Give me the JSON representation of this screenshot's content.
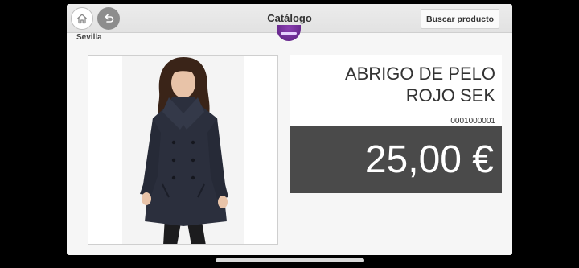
{
  "navbar": {
    "title": "Catálogo",
    "search_button_label": "Buscar producto",
    "home_icon": "home-icon",
    "back_icon": "undo-arrow-icon"
  },
  "store": {
    "location": "Sevilla"
  },
  "product": {
    "name_line1": "ABRIGO DE PELO",
    "name_line2": "ROJO SEK",
    "code": "0001000001",
    "price": "25,00 €"
  },
  "colors": {
    "price_background": "#4a4a4a",
    "coat": "#2b2f3d"
  }
}
